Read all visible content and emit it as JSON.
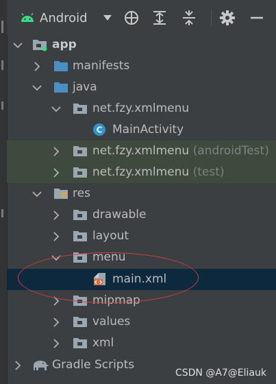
{
  "toolbar": {
    "view_label": "Android",
    "icons": [
      "android-icon",
      "dropdown-arrow-icon",
      "locate-icon",
      "expand-all-icon",
      "collapse-all-icon",
      "gear-icon",
      "minimize-icon"
    ]
  },
  "tree": {
    "app": "app",
    "manifests": "manifests",
    "java": "java",
    "pkg_main": "net.fzy.xmlmenu",
    "main_activity": "MainActivity",
    "pkg_android_test": "net.fzy.xmlmenu",
    "pkg_android_test_hint": "(androidTest)",
    "pkg_test": "net.fzy.xmlmenu",
    "pkg_test_hint": "(test)",
    "res": "res",
    "drawable": "drawable",
    "layout": "layout",
    "menu": "menu",
    "main_xml": "main.xml",
    "mipmap": "mipmap",
    "values": "values",
    "xml": "xml",
    "gradle_scripts": "Gradle Scripts"
  },
  "colors": {
    "background": "#3c3f41",
    "selected_row": "#0d293e",
    "test_row": "#3f4a3f",
    "folder_blue": "#4a8fc4",
    "android_green": "#3ddc84",
    "class_badge": "#3592c4",
    "annotation_red": "#d04040"
  },
  "watermark": "CSDN @A7@Eliauk"
}
